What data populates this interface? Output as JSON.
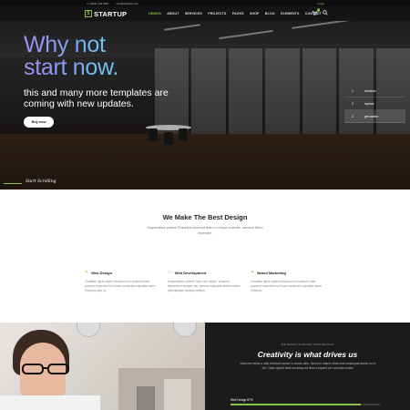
{
  "topbar": {
    "phone": "+1 (824) 123 4567",
    "email": "info@website.com",
    "login": "Login"
  },
  "navbar": {
    "logo_mark": "S",
    "logo_text": "STARTUP",
    "items": [
      {
        "label": "DEMOS",
        "active": true
      },
      {
        "label": "ABOUT",
        "active": false
      },
      {
        "label": "SERVICES",
        "active": false
      },
      {
        "label": "PROJECTS",
        "active": false
      },
      {
        "label": "PAGES",
        "active": false
      },
      {
        "label": "SHOP",
        "active": false
      },
      {
        "label": "BLOG",
        "active": false
      },
      {
        "label": "ELEMENTS",
        "active": false
      },
      {
        "label": "CONTACT",
        "active": false
      }
    ],
    "cart_icon": "cart-icon",
    "search_icon": "search-icon",
    "cart_count": "0",
    "accent": "#8bc34a"
  },
  "hero": {
    "title_line1": "Why not",
    "title_line2": "start now.",
    "subtitle": "this and many more templates are coming with new updates.",
    "cta": "Buy now",
    "scroll_text": "Start Scrolling",
    "slides": [
      {
        "num": "1",
        "label": "solutions",
        "active": false
      },
      {
        "num": "2",
        "label": "explore",
        "active": false
      },
      {
        "num": "3",
        "label": "get started",
        "active": true
      }
    ]
  },
  "design_section": {
    "title": "We Make The Best Design",
    "description": "Suspendisse potenti Phasellus euismod libero in neque molestie, mentum libero imperdiet.",
    "features": [
      {
        "icon": "pen-icon",
        "title": "Web Design",
        "body": "Curabitur ligula sapien tincidunt non euismod vitae posuere imperdiet leo Donec venenatis vulputate lorem Vivamus quis mi."
      },
      {
        "icon": "monitor-icon",
        "title": "Web Development",
        "body": "Suspendisse potenti. Nunc nec neque. Vivamus elementum semper nisi. Aenean vulputate eleifend tellus pellentesque facilisis pretium."
      },
      {
        "icon": "star-icon",
        "title": "Brand Marketing",
        "body": "Curabitur ligula sapien tincidunt non euismod vitae posuere imperdiet leo Donec venenatis vulputate lorem Vivamus."
      }
    ]
  },
  "bottom": {
    "small_heading": "WE BRING WINNING WEB DESIGN",
    "title": "Creativity is what drives us",
    "description": "Nam nec tellus a odio tincidunt auctor a ornare odio. Sed non mauris vitae erat consequat auctor eu in elit. Class aptent taciti sociosqu ad litora torquent per conubia nostra.",
    "skill_label": "Web Design 87%",
    "skill_value": 0.87
  }
}
